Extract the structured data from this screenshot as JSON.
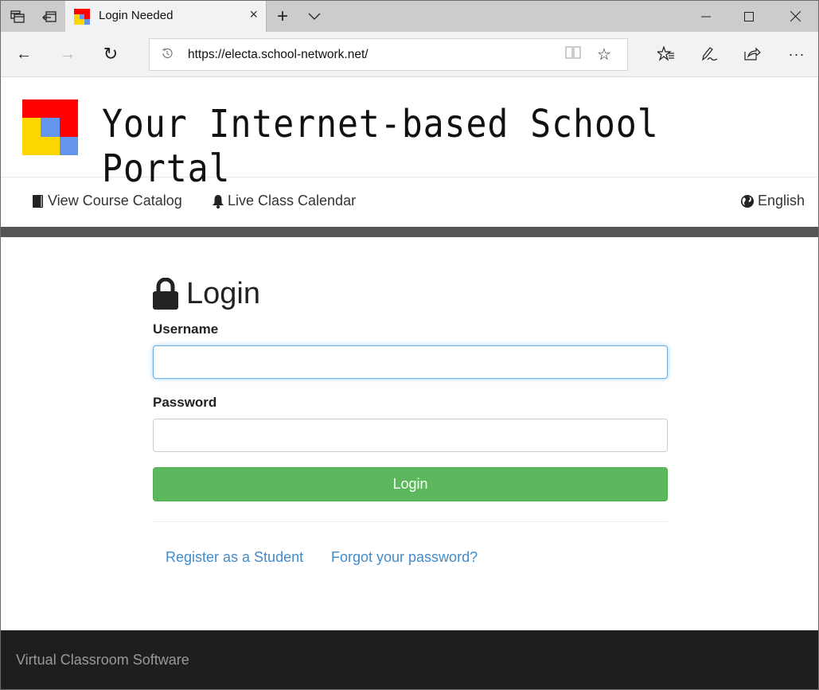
{
  "browser": {
    "tab_title": "Login Needed",
    "url": "https://electa.school-network.net/",
    "icons": {
      "tab_actions": "tab-set-aside-icon",
      "tab_preview": "tab-preview-icon",
      "new_tab": "+",
      "tab_list": "chevron-down-icon",
      "tab_close": "×",
      "minimize": "—",
      "maximize": "☐",
      "close": "✕",
      "back": "←",
      "forward": "→",
      "refresh": "↻",
      "history": "history-icon",
      "reading_view": "book-icon",
      "favorite": "☆",
      "favorites_hub": "favorites-list-icon",
      "notes": "pen-icon",
      "share": "share-icon",
      "more": "···"
    }
  },
  "header": {
    "title": "Your Internet-based School Portal",
    "logo_colors": {
      "red": "#ff0000",
      "yellow": "#ffd700",
      "blue": "#6495ed"
    }
  },
  "menu": {
    "items": [
      {
        "label": "View Course Catalog",
        "icon": "book-icon"
      },
      {
        "label": "Live Class Calendar",
        "icon": "bell-icon"
      }
    ],
    "language": {
      "label": "English",
      "icon": "globe-icon"
    }
  },
  "login": {
    "heading": "Login",
    "username_label": "Username",
    "username_value": "",
    "password_label": "Password",
    "password_value": "",
    "submit_label": "Login",
    "links": [
      {
        "label": "Register as a Student"
      },
      {
        "label": "Forgot your password?"
      }
    ]
  },
  "footer": {
    "text": "Virtual Classroom Software"
  },
  "colors": {
    "success": "#5cb85c",
    "link": "#428bca",
    "footer_bg": "#1e1e1e",
    "bar": "#555555"
  }
}
